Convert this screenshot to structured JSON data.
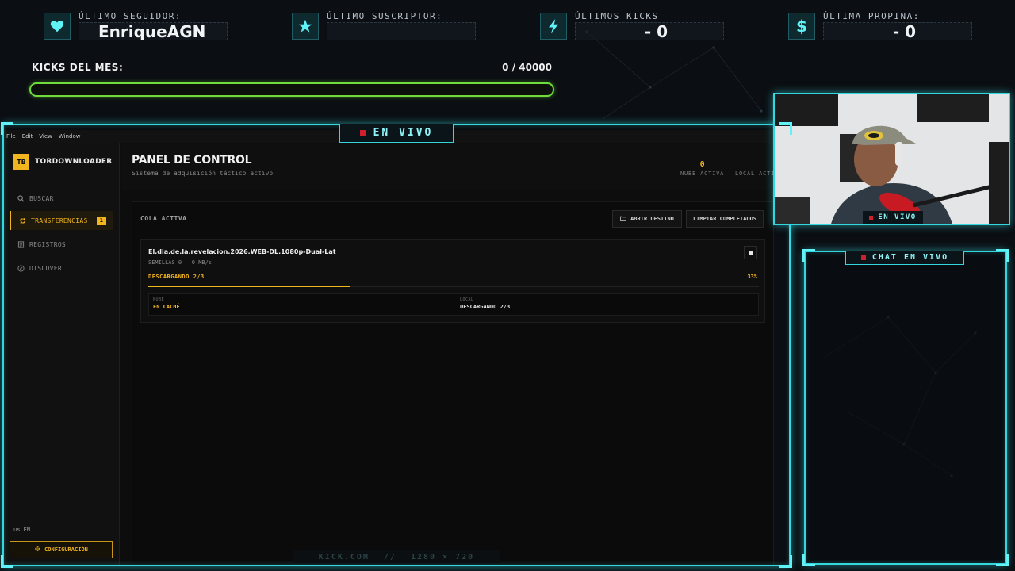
{
  "colors": {
    "cyan": "#34d7de",
    "green": "#6fdc3b",
    "gold": "#f2b51d",
    "red": "#d11f2c"
  },
  "stats": [
    {
      "label": "ÚLTIMO SEGUIDOR:",
      "value": "EnriqueAGN",
      "icon": "heart-icon"
    },
    {
      "label": "ÚLTIMO SUSCRIPTOR:",
      "value": "_",
      "icon": "star-icon"
    },
    {
      "label": "ÚLTIMOS KICKS",
      "value": "_ - 0",
      "icon": "lightning-icon"
    },
    {
      "label": "ÚLTIMA PROPINA:",
      "value": "_ - 0",
      "icon": "dollar-icon"
    }
  ],
  "kicks": {
    "title": "KICKS DEL MES:",
    "count": "0 / 40000",
    "progress": 0
  },
  "live_label": "EN VIVO",
  "app": {
    "menu": [
      "File",
      "Edit",
      "View",
      "Window"
    ],
    "brand_badge": "TB",
    "brand_name": "TORDOWNLOADER",
    "nav": [
      {
        "label": "BUSCAR",
        "icon": "search-icon"
      },
      {
        "label": "TRANSFERENCIAS",
        "icon": "transfer-icon",
        "badge": "1",
        "active": true
      },
      {
        "label": "REGISTROS",
        "icon": "log-icon"
      },
      {
        "label": "DISCOVER",
        "icon": "compass-icon"
      }
    ],
    "lang": "us EN",
    "config_label": "CONFIGURACIÓN",
    "page_title": "PANEL DE CONTROL",
    "page_subtitle": "Sistema de adquisición táctico activo",
    "head_stats": [
      {
        "value": "0",
        "label": "NUBE ACTIVA"
      },
      {
        "value": "",
        "label": "LOCAL ACTI"
      }
    ],
    "queue_title": "COLA ACTIVA",
    "open_dest_label": "ABRIR DESTINO",
    "clear_label": "LIMPIAR COMPLETADOS",
    "download": {
      "name": "El.dia.de.la.revelacion.2026.WEB-DL.1080p-Dual-Lat",
      "meta": "SEMILLAS 0   0 MB/s",
      "status": "DESCARGANDO 2/3",
      "percent_label": "33%",
      "progress": 0.33,
      "cloud_key": "NUBE",
      "cloud_value": "EN CACHÉ",
      "local_key": "LOCAL",
      "local_value": "DESCARGANDO 2/3"
    }
  },
  "footer": {
    "site": "KICK.COM",
    "sep": "//",
    "res": "1280 × 720"
  },
  "chat_title": "CHAT EN VIVO"
}
